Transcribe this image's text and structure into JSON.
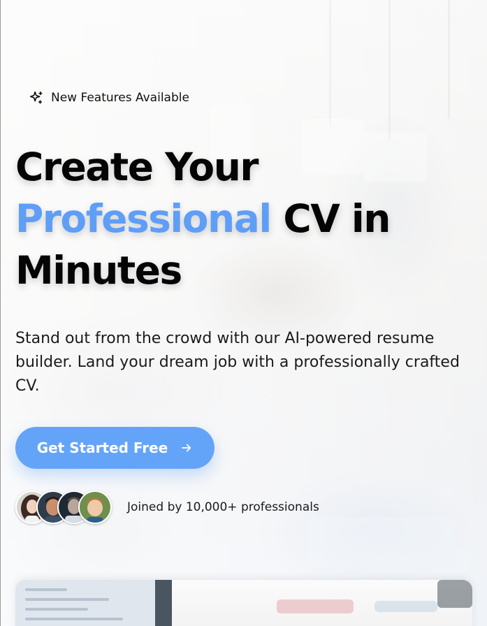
{
  "badge": {
    "icon": "sparkles-icon",
    "text": "New Features Available"
  },
  "hero": {
    "headline_line1": "Create Your",
    "headline_accent": "Professional",
    "headline_line2_rest": " CV in",
    "headline_line3": "Minutes",
    "subtext": "Stand out from the crowd with our AI-powered resume builder. Land your dream job with a professionally crafted CV."
  },
  "cta": {
    "label": "Get Started Free",
    "icon": "arrow-right-icon"
  },
  "social_proof": {
    "text": "Joined by 10,000+ professionals",
    "avatars": [
      "avatar-woman",
      "avatar-child",
      "avatar-man",
      "avatar-boy"
    ]
  },
  "colors": {
    "accent": "#5f9ef7",
    "button": "#64a4f8",
    "headline": "#050505"
  }
}
